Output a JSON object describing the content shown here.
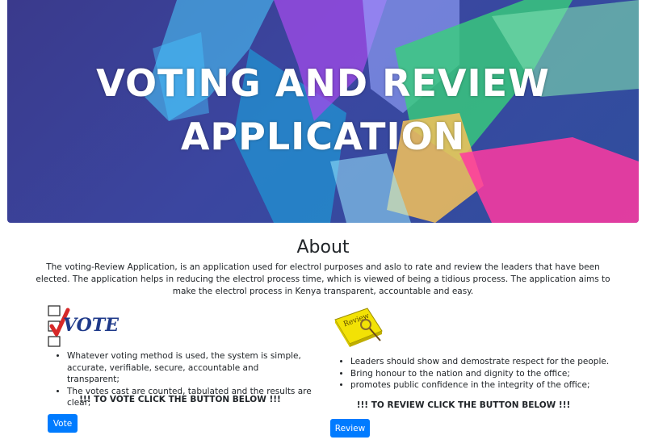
{
  "hero": {
    "title_line1": "VOTING AND REVIEW",
    "title_line2": "APPLICATION"
  },
  "about": {
    "heading": "About",
    "text": "The voting-Review Application, is an application used for electrol purposes and aslo to rate and review the leaders that have been elected. The application helps in reducing the electrol process time, which is viewed of being a tidious process. The application aims to make the electrol process in Kenya transparent, accountable and easy."
  },
  "vote": {
    "logo_text": "VOTE",
    "points": [
      "Whatever voting method is used, the system is simple, accurate, verifiable, secure, accountable and transparent;",
      "The votes cast are counted, tabulated and the results are clear;"
    ],
    "call_to_action": "!!! TO VOTE CLICK THE BUTTON BELOW !!!",
    "button_label": "Vote"
  },
  "review": {
    "logo_text": "Review",
    "points": [
      "Leaders should show and demostrate respect for the people.",
      "Bring honour to the nation and dignity to the office;",
      "promotes public confidence in the integrity of the office;"
    ],
    "call_to_action": "!!! TO REVIEW CLICK THE BUTTON BELOW !!!",
    "button_label": "Review"
  },
  "colors": {
    "primary_button": "#007bff",
    "hero_background": "#3b46a0",
    "vote_logo": "#1f3a8a",
    "vote_check": "#d62828",
    "review_book": "#f2e205"
  }
}
